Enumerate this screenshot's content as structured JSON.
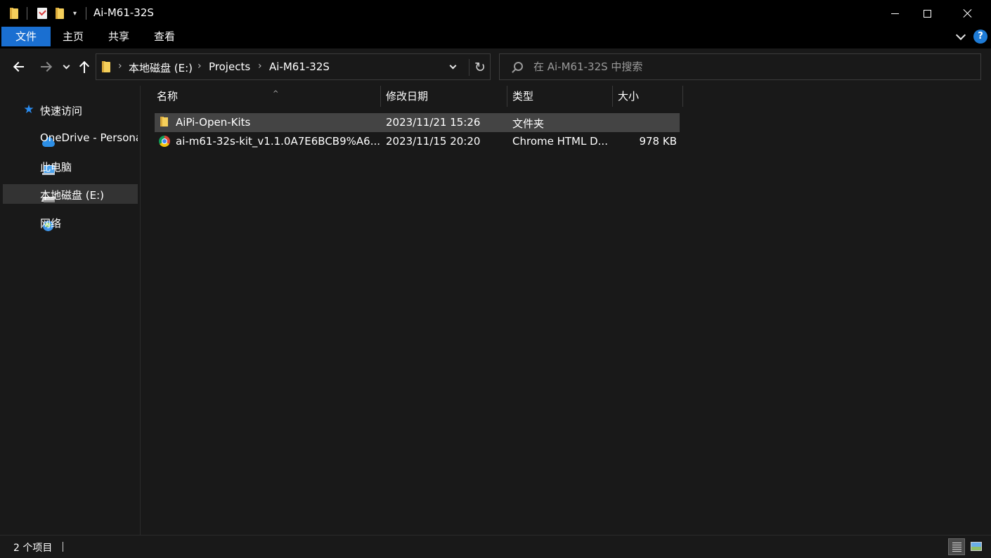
{
  "window": {
    "title": "Ai-M61-32S",
    "quick_access_dropdown": "▾"
  },
  "ribbon": {
    "tabs": [
      {
        "label": "文件"
      },
      {
        "label": "主页"
      },
      {
        "label": "共享"
      },
      {
        "label": "查看"
      }
    ],
    "help_label": "?"
  },
  "navigation": {
    "breadcrumb": [
      "本地磁盘 (E:)",
      "Projects",
      "Ai-M61-32S"
    ],
    "separator": "›",
    "refresh_glyph": "↻"
  },
  "search": {
    "placeholder": "在 Ai-M61-32S 中搜索",
    "value": ""
  },
  "sidebar": {
    "items": [
      {
        "label": "快速访问",
        "icon": "star-icon"
      },
      {
        "label": "OneDrive - Personal",
        "icon": "cloud-icon"
      },
      {
        "label": "此电脑",
        "icon": "computer-icon"
      },
      {
        "label": "本地磁盘 (E:)",
        "icon": "drive-icon",
        "selected": true
      },
      {
        "label": "网络",
        "icon": "network-icon"
      }
    ]
  },
  "file_list": {
    "columns": [
      "名称",
      "修改日期",
      "类型",
      "大小"
    ],
    "sort_indicator": "^",
    "rows": [
      {
        "name": "AiPi-Open-Kits",
        "modified": "2023/11/21 15:26",
        "type": "文件夹",
        "size": "",
        "icon": "folder-icon",
        "selected": true
      },
      {
        "name": "ai-m61-32s-kit_v1.1.0A7E6BCB9%A6...",
        "modified": "2023/11/15 20:20",
        "type": "Chrome HTML D...",
        "size": "978 KB",
        "icon": "chrome-icon",
        "selected": false
      }
    ]
  },
  "status": {
    "item_count": "2 个项目"
  },
  "colors": {
    "accent": "#1a6fd1",
    "background": "#191919",
    "selection": "#444444"
  }
}
